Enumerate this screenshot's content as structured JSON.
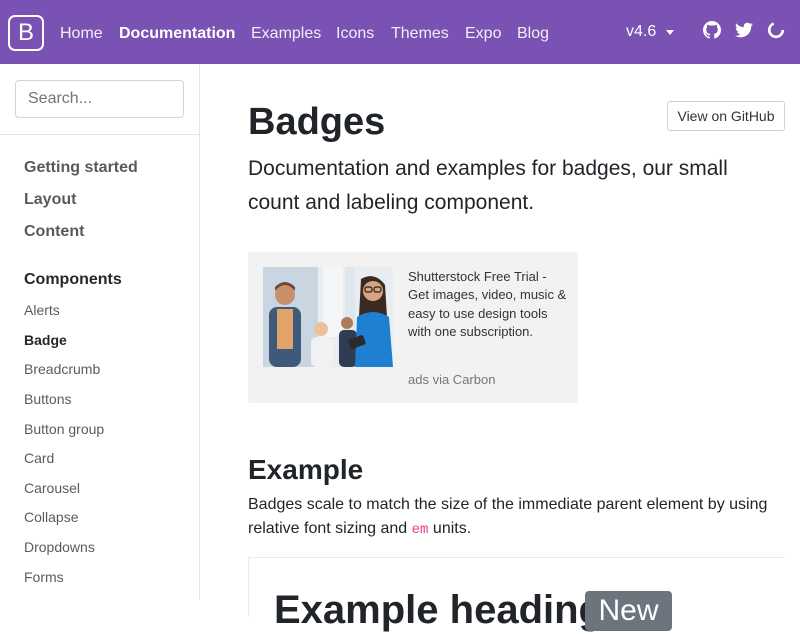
{
  "navbar": {
    "brand": "B",
    "links": [
      "Home",
      "Documentation",
      "Examples",
      "Icons",
      "Themes",
      "Expo",
      "Blog"
    ],
    "active_link": "Documentation",
    "version": "v4.6",
    "icons": [
      "github-icon",
      "twitter-icon",
      "slack-icon"
    ],
    "bg_color": "#7952b3"
  },
  "sidebar": {
    "search_placeholder": "Search...",
    "groups": [
      "Getting started",
      "Layout",
      "Content",
      "Components"
    ],
    "items": [
      "Alerts",
      "Badge",
      "Breadcrumb",
      "Buttons",
      "Button group",
      "Card",
      "Carousel",
      "Collapse",
      "Dropdowns",
      "Forms"
    ],
    "active_item": "Badge"
  },
  "main": {
    "title": "Badges",
    "github_button": "View on GitHub",
    "lead": "Documentation and examples for badges, our small count and labeling component.",
    "ad": {
      "text": "Shutterstock Free Trial - Get images, video, music & easy to use design tools with one subscription.",
      "via": "ads via Carbon"
    },
    "example_heading": "Example",
    "example_para_before": "Badges scale to match the size of the immediate parent element by using relative font sizing and ",
    "example_para_code": "em",
    "example_para_after": " units.",
    "example_preview_heading": "Example heading",
    "example_preview_badge": "New"
  }
}
